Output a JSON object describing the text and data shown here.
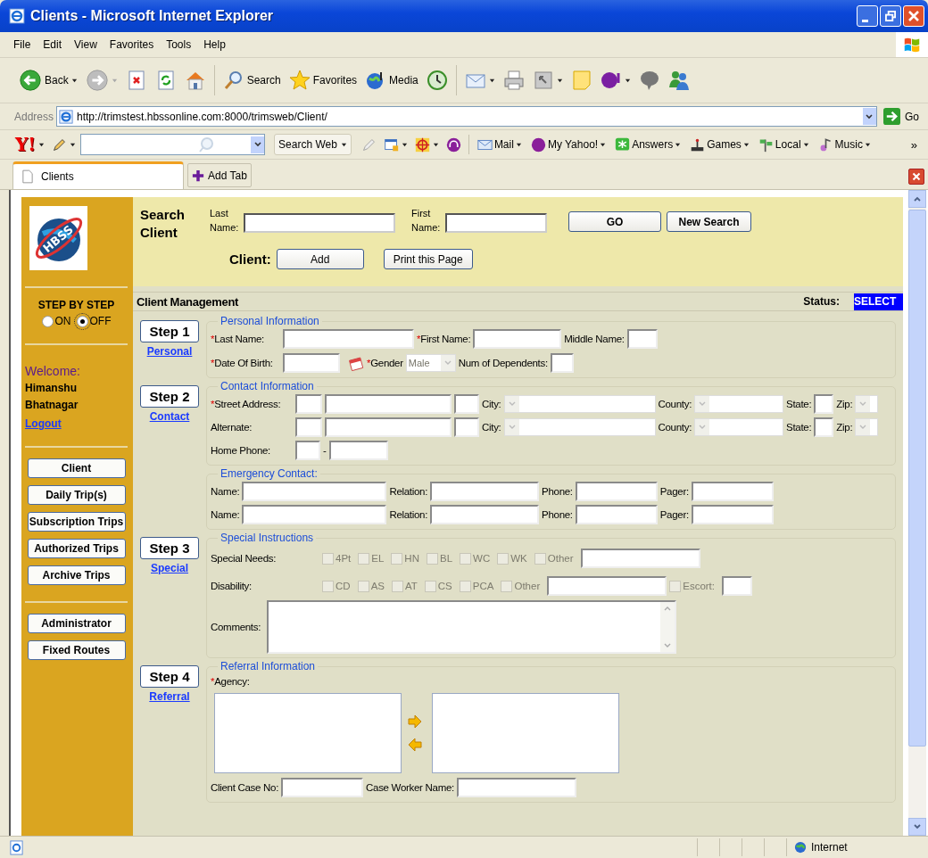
{
  "window": {
    "title": "Clients - Microsoft Internet Explorer"
  },
  "menu": [
    "File",
    "Edit",
    "View",
    "Favorites",
    "Tools",
    "Help"
  ],
  "toolbar": [
    {
      "kind": "back",
      "label": "Back",
      "dropdown": true
    },
    {
      "kind": "forward",
      "dropdown": true
    },
    {
      "kind": "stop",
      "dropdown": false
    },
    {
      "kind": "refresh",
      "dropdown": false
    },
    {
      "kind": "home",
      "dropdown": false
    },
    {
      "kind": "separator"
    },
    {
      "kind": "search",
      "label": "Search",
      "dropdown": false
    },
    {
      "kind": "favorites",
      "label": "Favorites",
      "dropdown": false
    },
    {
      "kind": "media",
      "label": "Media",
      "dropdown": false
    },
    {
      "kind": "history",
      "dropdown": false
    },
    {
      "kind": "separator"
    },
    {
      "kind": "mail",
      "dropdown": true
    },
    {
      "kind": "print",
      "dropdown": false
    },
    {
      "kind": "edit",
      "dropdown": true
    },
    {
      "kind": "note",
      "dropdown": false
    },
    {
      "kind": "yahoo",
      "dropdown": true
    },
    {
      "kind": "discuss",
      "dropdown": false
    },
    {
      "kind": "messenger",
      "dropdown": false
    }
  ],
  "address": {
    "label": "Address",
    "url": "http://trimstest.hbssonline.com:8000/trimsweb/Client/",
    "go": "Go"
  },
  "yahoo_bar": {
    "logo": "Y!",
    "search_button": "Search Web",
    "tools": [
      {
        "kind": "pencil",
        "dropdown": false
      },
      {
        "kind": "window",
        "dropdown": true
      },
      {
        "kind": "target",
        "dropdown": true
      },
      {
        "kind": "headphones",
        "dropdown": false
      }
    ],
    "links": [
      {
        "kind": "mail",
        "label": "Mail"
      },
      {
        "kind": "myyahoo",
        "label": "My Yahoo!"
      },
      {
        "kind": "answers",
        "label": "Answers"
      },
      {
        "kind": "games",
        "label": "Games"
      },
      {
        "kind": "local",
        "label": "Local"
      },
      {
        "kind": "music",
        "label": "Music"
      }
    ],
    "more": "»"
  },
  "tabs": [
    {
      "label": "Clients",
      "selected": true
    }
  ],
  "add_tab": "Add Tab",
  "sidebar": {
    "logo_text": "HBSS",
    "step_title": "STEP BY STEP",
    "step_options": [
      {
        "label": "ON",
        "selected": false
      },
      {
        "label": "OFF",
        "selected": true
      }
    ],
    "welcome": "Welcome: **Himanshu Bhatnagar**",
    "logout": "Logout",
    "nav": [
      "Client",
      "Daily Trip(s)",
      "Subscription Trips",
      "Authorized Trips",
      "Archive Trips"
    ],
    "admin": [
      "Administrator",
      "Fixed Routes"
    ]
  },
  "search": {
    "title": "Search Client",
    "last_label": "Last Name:",
    "first_label": "First Name:",
    "go": "GO",
    "new_search": "New Search",
    "client_label": "Client:",
    "add": "Add",
    "print": "Print this Page"
  },
  "management": {
    "title": "Client Management",
    "status_label": "Status:",
    "status": "SELECT"
  },
  "sections": [
    {
      "step": "Step 1",
      "link": "Personal",
      "legend": "Personal Information",
      "rows": [
        {
          "fields": [
            {
              "kind": "label",
              "text": "Last Name:",
              "mark": "*"
            },
            {
              "kind": "input"
            },
            {
              "kind": "label",
              "text": "First Name:",
              "mark": "*"
            },
            {
              "kind": "input"
            },
            {
              "kind": "label",
              "text": "Middle Name:"
            },
            {
              "kind": "input"
            }
          ]
        },
        {
          "fields": [
            {
              "kind": "label",
              "text": "Date Of Birth:",
              "mark": "*"
            },
            {
              "kind": "input"
            },
            {
              "kind": "calendar"
            },
            {
              "kind": "label",
              "text": "Gender",
              "mark": "*"
            },
            {
              "kind": "select",
              "value": "Male",
              "disabled": true
            },
            {
              "kind": "label",
              "text": "Num of Dependents:"
            },
            {
              "kind": "input"
            }
          ]
        }
      ]
    },
    {
      "step": "Step 2",
      "link": "Contact",
      "legend": "Contact Information",
      "rows": [
        {
          "fields": [
            {
              "kind": "label",
              "text": "Street Address:",
              "mark": "*"
            },
            {
              "kind": "input"
            },
            {
              "kind": "input"
            },
            {
              "kind": "input"
            },
            {
              "kind": "label",
              "text": "City:"
            },
            {
              "kind": "select",
              "disabled": true
            },
            {
              "kind": "label",
              "text": "County:"
            },
            {
              "kind": "select",
              "disabled": true
            },
            {
              "kind": "label",
              "text": "State:"
            },
            {
              "kind": "input"
            },
            {
              "kind": "label",
              "text": "Zip:"
            },
            {
              "kind": "select",
              "disabled": true
            }
          ]
        },
        {
          "fields": [
            {
              "kind": "label",
              "text": "Alternate:"
            },
            {
              "kind": "input"
            },
            {
              "kind": "input"
            },
            {
              "kind": "input"
            },
            {
              "kind": "label",
              "text": "City:"
            },
            {
              "kind": "select",
              "disabled": true
            },
            {
              "kind": "label",
              "text": "County:"
            },
            {
              "kind": "select",
              "disabled": true
            },
            {
              "kind": "label",
              "text": "State:"
            },
            {
              "kind": "input"
            },
            {
              "kind": "label",
              "text": "Zip:"
            },
            {
              "kind": "select",
              "disabled": true
            }
          ]
        },
        {
          "fields": [
            {
              "kind": "label",
              "text": "Home Phone:"
            },
            {
              "kind": "input"
            },
            {
              "kind": "dash",
              "text": "-"
            },
            {
              "kind": "input"
            }
          ]
        }
      ]
    },
    {
      "legend": "Emergency Contact:",
      "rows": [
        {
          "fields": [
            {
              "kind": "label",
              "text": "Name:"
            },
            {
              "kind": "input"
            },
            {
              "kind": "label",
              "text": "Relation:"
            },
            {
              "kind": "input"
            },
            {
              "kind": "label",
              "text": "Phone:"
            },
            {
              "kind": "input"
            },
            {
              "kind": "label",
              "text": "Pager:"
            },
            {
              "kind": "input"
            }
          ]
        },
        {
          "fields": [
            {
              "kind": "label",
              "text": "Name:"
            },
            {
              "kind": "input"
            },
            {
              "kind": "label",
              "text": "Relation:"
            },
            {
              "kind": "input"
            },
            {
              "kind": "label",
              "text": "Phone:"
            },
            {
              "kind": "input"
            },
            {
              "kind": "label",
              "text": "Pager:"
            },
            {
              "kind": "input"
            }
          ]
        }
      ]
    },
    {
      "step": "Step 3",
      "link": "Special",
      "legend": "Special Instructions",
      "rows": [
        {
          "fields": [
            {
              "kind": "label",
              "text": "Special Needs:"
            },
            {
              "kind": "check",
              "label": "4Pt",
              "checked": false,
              "disabled": true
            },
            {
              "kind": "check",
              "label": "EL",
              "checked": false,
              "disabled": true
            },
            {
              "kind": "check",
              "label": "HN",
              "checked": false,
              "disabled": true
            },
            {
              "kind": "check",
              "label": "BL",
              "checked": false,
              "disabled": true
            },
            {
              "kind": "check",
              "label": "WC",
              "checked": false,
              "disabled": true
            },
            {
              "kind": "check",
              "label": "WK",
              "checked": false,
              "disabled": true
            },
            {
              "kind": "check",
              "label": "Other",
              "checked": false,
              "disabled": true
            },
            {
              "kind": "input"
            }
          ]
        },
        {
          "fields": [
            {
              "kind": "label",
              "text": "Disability:"
            },
            {
              "kind": "check",
              "label": "CD",
              "checked": false,
              "disabled": true
            },
            {
              "kind": "check",
              "label": "AS",
              "checked": false,
              "disabled": true
            },
            {
              "kind": "check",
              "label": "AT",
              "checked": false,
              "disabled": true
            },
            {
              "kind": "check",
              "label": "CS",
              "checked": false,
              "disabled": true
            },
            {
              "kind": "check",
              "label": "PCA",
              "checked": false,
              "disabled": true
            },
            {
              "kind": "check",
              "label": "Other",
              "checked": false,
              "disabled": true
            },
            {
              "kind": "input"
            },
            {
              "kind": "check",
              "label": "Escort:",
              "checked": false,
              "disabled": true
            },
            {
              "kind": "input"
            }
          ]
        },
        {
          "fields": [
            {
              "kind": "label",
              "text": "Comments:"
            },
            {
              "kind": "textarea"
            }
          ]
        }
      ]
    },
    {
      "step": "Step 4",
      "link": "Referral",
      "legend": "Referral Information",
      "rows": [
        {
          "fields": [
            {
              "kind": "label",
              "text": "Agency:",
              "mark": "*"
            }
          ]
        },
        {
          "fields": [
            {
              "kind": "listbox"
            },
            {
              "kind": "arrows"
            },
            {
              "kind": "listbox"
            }
          ]
        },
        {
          "fields": [
            {
              "kind": "label",
              "text": "Client Case No:"
            },
            {
              "kind": "input"
            },
            {
              "kind": "label",
              "text": "Case Worker Name:"
            },
            {
              "kind": "input"
            }
          ]
        }
      ]
    }
  ],
  "status_bar": {
    "zone": "Internet"
  }
}
